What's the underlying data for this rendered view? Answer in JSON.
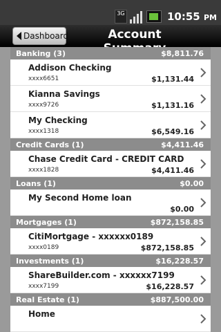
{
  "status": {
    "network": "3G",
    "clock": "10:55",
    "ampm": "PM"
  },
  "header": {
    "back_label": "Dashboard",
    "title": "Account Summary"
  },
  "sections": [
    {
      "label": "Banking (3)",
      "total": "$8,811.76",
      "rows": [
        {
          "name": "Addison Checking",
          "acct": "xxxx6651",
          "amount": "$1,131.44"
        },
        {
          "name": "Kianna Savings",
          "acct": "xxxx9726",
          "amount": "$1,131.16"
        },
        {
          "name": "My Checking",
          "acct": "xxxx1318",
          "amount": "$6,549.16"
        }
      ]
    },
    {
      "label": "Credit Cards (1)",
      "total": "$4,411.46",
      "rows": [
        {
          "name": "Chase Credit Card - CREDIT CARD",
          "acct": "xxxx1828",
          "amount": "$4,411.46"
        }
      ]
    },
    {
      "label": "Loans (1)",
      "total": "$0.00",
      "rows": [
        {
          "name": "My Second Home loan",
          "acct": "",
          "amount": "$0.00"
        }
      ]
    },
    {
      "label": "Mortgages (1)",
      "total": "$872,158.85",
      "rows": [
        {
          "name": "CitiMortgage - xxxxxx0189",
          "acct": "xxxx0189",
          "amount": "$872,158.85"
        }
      ]
    },
    {
      "label": "Investments (1)",
      "total": "$16,228.57",
      "rows": [
        {
          "name": "ShareBuilder.com - xxxxxx7199",
          "acct": "xxxx7199",
          "amount": "$16,228.57"
        }
      ]
    },
    {
      "label": "Real Estate (1)",
      "total": "$887,500.00",
      "rows": [
        {
          "name": "Home",
          "acct": "",
          "amount": ""
        }
      ]
    }
  ]
}
